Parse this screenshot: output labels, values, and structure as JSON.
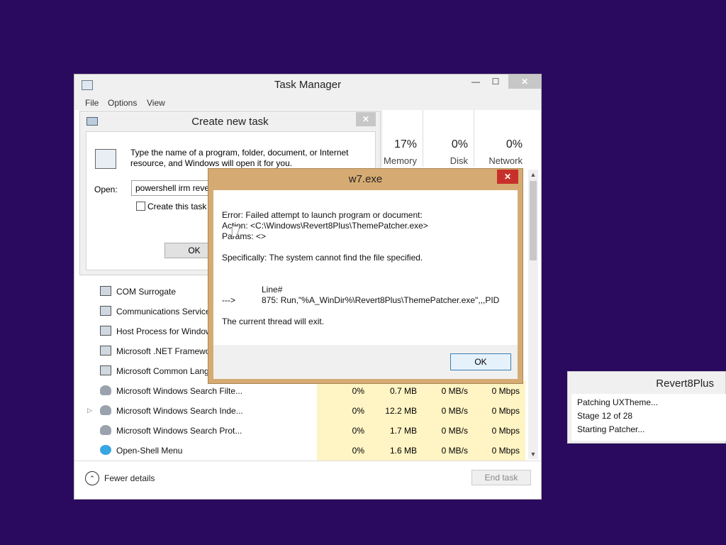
{
  "task_manager": {
    "title": "Task Manager",
    "menu": [
      "File",
      "Options",
      "View"
    ],
    "columns": [
      {
        "pct": "17%",
        "label": "Memory"
      },
      {
        "pct": "0%",
        "label": "Disk"
      },
      {
        "pct": "0%",
        "label": "Network"
      }
    ],
    "processes": [
      {
        "name": "COM Surrogate",
        "icon": "app-icon",
        "cpu": "",
        "memory": "",
        "disk": "",
        "network": ""
      },
      {
        "name": "Communications Service",
        "icon": "app-icon",
        "cpu": "",
        "memory": "",
        "disk": "",
        "network": ""
      },
      {
        "name": "Host Process for Windows",
        "icon": "app-icon",
        "cpu": "",
        "memory": "",
        "disk": "",
        "network": ""
      },
      {
        "name": "Microsoft .NET Framework",
        "icon": "app-icon",
        "cpu": "",
        "memory": "",
        "disk": "",
        "network": ""
      },
      {
        "name": "Microsoft Common Lang",
        "icon": "app-icon",
        "cpu": "",
        "memory": "",
        "disk": "",
        "network": ""
      },
      {
        "name": "Microsoft Windows Search Filte...",
        "icon": "user-icon",
        "cpu": "0%",
        "memory": "0.7 MB",
        "disk": "0 MB/s",
        "network": "0 Mbps"
      },
      {
        "name": "Microsoft Windows Search Inde...",
        "icon": "user-icon",
        "cpu": "0%",
        "memory": "12.2 MB",
        "disk": "0 MB/s",
        "network": "0 Mbps"
      },
      {
        "name": "Microsoft Windows Search Prot...",
        "icon": "user-icon",
        "cpu": "0%",
        "memory": "1.7 MB",
        "disk": "0 MB/s",
        "network": "0 Mbps"
      },
      {
        "name": "Open-Shell Menu",
        "icon": "globe-icon",
        "cpu": "0%",
        "memory": "1.6 MB",
        "disk": "0 MB/s",
        "network": "0 Mbps"
      }
    ],
    "fewer_details": "Fewer details",
    "end_task": "End task"
  },
  "create_task": {
    "title": "Create new task",
    "description": "Type the name of a program, folder, document, or Internet resource, and Windows will open it for you.",
    "open_label": "Open:",
    "open_value": "powershell irm reve",
    "checkbox_label": "Create this task w",
    "ok_label": "OK"
  },
  "error_dialog": {
    "title": "w7.exe",
    "lines": [
      "Error:  Failed attempt to launch program or document:",
      "Action: <C:\\Windows\\Revert8Plus\\ThemePatcher.exe>",
      "Params: <>",
      "Specifically: The system cannot find the file specified.",
      "Line#",
      "--->",
      "875: Run,\"%A_WinDir%\\Revert8Plus\\ThemePatcher.exe\",,,PID",
      "The current thread will exit."
    ],
    "ok_label": "OK"
  },
  "revert8plus": {
    "title": "Revert8Plus",
    "lines": [
      "Patching UXTheme...",
      "Stage 12 of 28",
      "Starting Patcher..."
    ]
  }
}
